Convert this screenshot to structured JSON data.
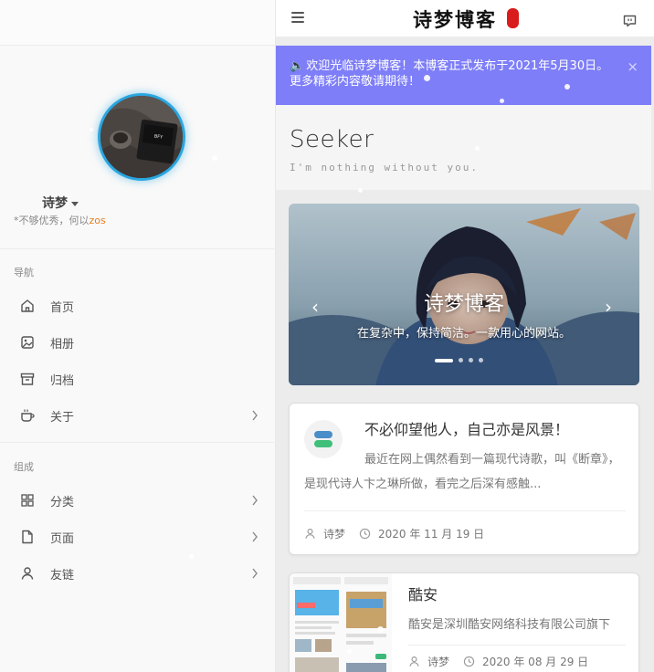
{
  "sidebar": {
    "user": {
      "name": "诗梦",
      "motto_prefix": "*不够优秀，何以",
      "motto_highlight": "zos"
    },
    "sections": [
      {
        "title": "导航",
        "items": [
          {
            "label": "首页",
            "icon": "home-icon",
            "arrow": false
          },
          {
            "label": "相册",
            "icon": "image-icon",
            "arrow": false
          },
          {
            "label": "归档",
            "icon": "archive-icon",
            "arrow": false
          },
          {
            "label": "关于",
            "icon": "coffee-icon",
            "arrow": true
          }
        ]
      },
      {
        "title": "组成",
        "items": [
          {
            "label": "分类",
            "icon": "grid-icon",
            "arrow": true
          },
          {
            "label": "页面",
            "icon": "file-icon",
            "arrow": true
          },
          {
            "label": "友链",
            "icon": "user-icon",
            "arrow": true
          }
        ]
      }
    ]
  },
  "header": {
    "logo": "诗梦博客",
    "menu_icon": "menu-icon",
    "chat_icon": "chat-icon"
  },
  "notice": {
    "text": "欢迎光临诗梦博客！本博客正式发布于2021年5月30日。更多精彩内容敬请期待！",
    "close": "×"
  },
  "page": {
    "title": "Seeker",
    "subtitle": "I'm nothing without you."
  },
  "banner": {
    "title": "诗梦博客",
    "description": "在复杂中，保持简洁。一款用心的网站。",
    "prev": "‹",
    "next": "›",
    "slides": 4,
    "active": 1
  },
  "posts": [
    {
      "title": "不必仰望他人，自己亦是风景！",
      "excerpt": "最近在网上偶然看到一篇现代诗歌，叫《断章》，是现代诗人卞之琳所做，看完之后深有感触...",
      "author": "诗梦",
      "date": "2020 年 11 月 19 日"
    },
    {
      "title": "酷安",
      "excerpt": "酷安是深圳酷安网络科技有限公司旗下",
      "author": "诗梦",
      "date": "2020 年 08 月 29 日"
    }
  ],
  "colors": {
    "accent": "#7e7ef8",
    "avatar_ring": "#2aa6e0",
    "highlight": "#e67e22"
  }
}
